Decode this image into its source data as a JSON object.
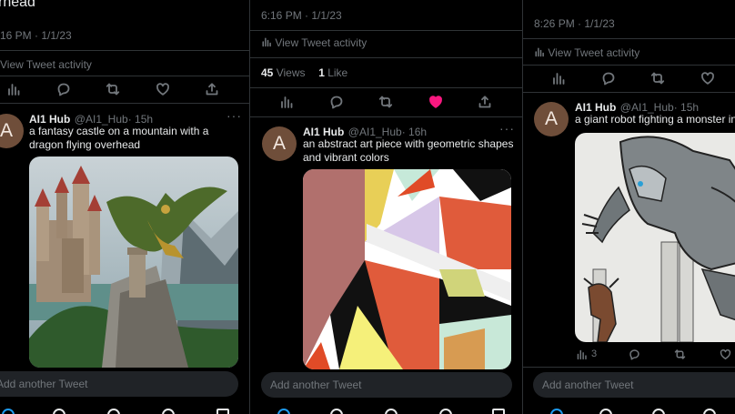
{
  "colors": {
    "background": "#000000",
    "text": "#e7e9ea",
    "muted": "#71767b",
    "like_active": "#f91880"
  },
  "left": {
    "top_text": "rhead",
    "timestamp": "16 PM · 1/1/23",
    "activity": "View Tweet activity",
    "tweet": {
      "avatar": "A",
      "name": "AI1 Hub",
      "handle": "@AI1_Hub",
      "time": "· 15h",
      "text": "a fantasy castle on a mountain with a dragon flying overhead"
    },
    "reply_placeholder": "Add another Tweet"
  },
  "middle": {
    "timestamp": "6:16 PM · 1/1/23",
    "activity": "View Tweet activity",
    "views_count": "45",
    "views_label": "Views",
    "likes_count": "1",
    "likes_label": "Like",
    "tweet": {
      "avatar": "A",
      "name": "AI1 Hub",
      "handle": "@AI1_Hub",
      "time": "· 16h",
      "text": "an abstract art piece with geometric shapes and vibrant colors"
    },
    "reply_placeholder": "Add another Tweet"
  },
  "right": {
    "timestamp": "8:26 PM · 1/1/23",
    "activity": "View Tweet activity",
    "tweet": {
      "avatar": "A",
      "name": "AI1 Hub",
      "handle": "@AI1_Hub",
      "time": "· 15h",
      "text": "a giant robot fighting a monster in",
      "analytics_count": "3"
    },
    "reply_placeholder": "Add another Tweet"
  },
  "icons": {
    "analytics": "bar-chart-icon",
    "reply": "speech-bubble-icon",
    "retweet": "retweet-arrows-icon",
    "like": "heart-icon",
    "share": "share-upload-icon",
    "more": "ellipsis-icon"
  }
}
